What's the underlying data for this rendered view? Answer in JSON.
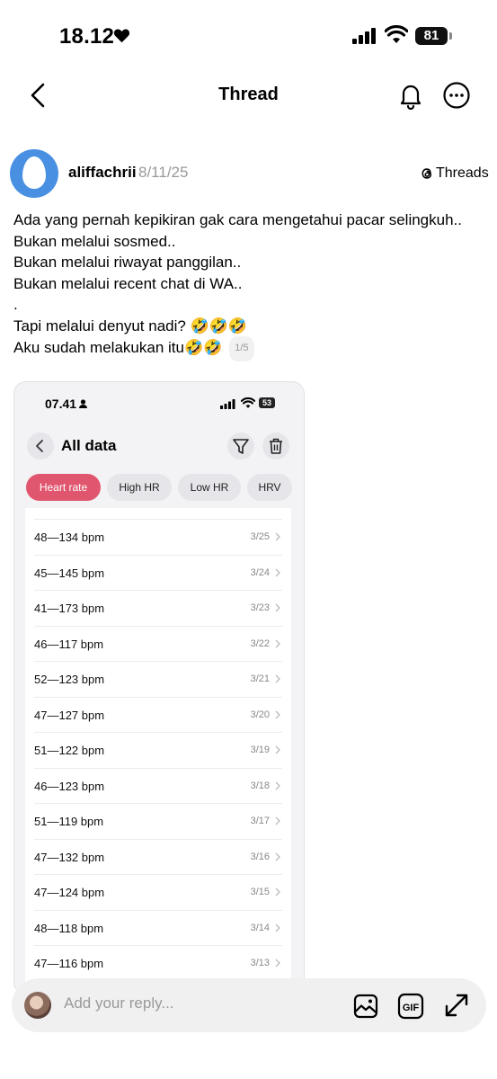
{
  "status_bar": {
    "time": "18.12",
    "battery": "81"
  },
  "nav": {
    "title": "Thread"
  },
  "post": {
    "username": "aliffachrii",
    "date": "8/11/25",
    "source_label": "Threads",
    "lines": [
      "Ada yang pernah kepikiran gak cara mengetahui pacar selingkuh..",
      "Bukan melalui sosmed..",
      "Bukan melalui riwayat panggilan..",
      "Bukan melalui recent chat di WA..",
      ".",
      "Tapi melalui denyut nadi? 🤣🤣🤣",
      "Aku sudah melakukan itu🤣🤣"
    ],
    "page_indicator": "1/5"
  },
  "attached_screenshot": {
    "status_time": "07.41",
    "battery": "53",
    "title": "All data",
    "chips": [
      "Heart rate",
      "High HR",
      "Low HR",
      "HRV"
    ],
    "active_chip": "Heart rate",
    "records": [
      {
        "range": "48—134 bpm",
        "date": "3/25"
      },
      {
        "range": "45—145 bpm",
        "date": "3/24"
      },
      {
        "range": "41—173 bpm",
        "date": "3/23"
      },
      {
        "range": "46—117 bpm",
        "date": "3/22"
      },
      {
        "range": "52—123 bpm",
        "date": "3/21"
      },
      {
        "range": "47—127 bpm",
        "date": "3/20"
      },
      {
        "range": "51—122 bpm",
        "date": "3/19"
      },
      {
        "range": "46—123 bpm",
        "date": "3/18"
      },
      {
        "range": "51—119 bpm",
        "date": "3/17"
      },
      {
        "range": "47—132 bpm",
        "date": "3/16"
      },
      {
        "range": "47—124 bpm",
        "date": "3/15"
      },
      {
        "range": "48—118 bpm",
        "date": "3/14"
      },
      {
        "range": "47—116 bpm",
        "date": "3/13"
      }
    ],
    "colors": {
      "active_chip": "#e0566e"
    }
  },
  "reply": {
    "placeholder": "Add your reply...",
    "gif_label": "GIF"
  },
  "colors": {
    "avatar": "#4a90e2",
    "muted_text": "#999999"
  }
}
